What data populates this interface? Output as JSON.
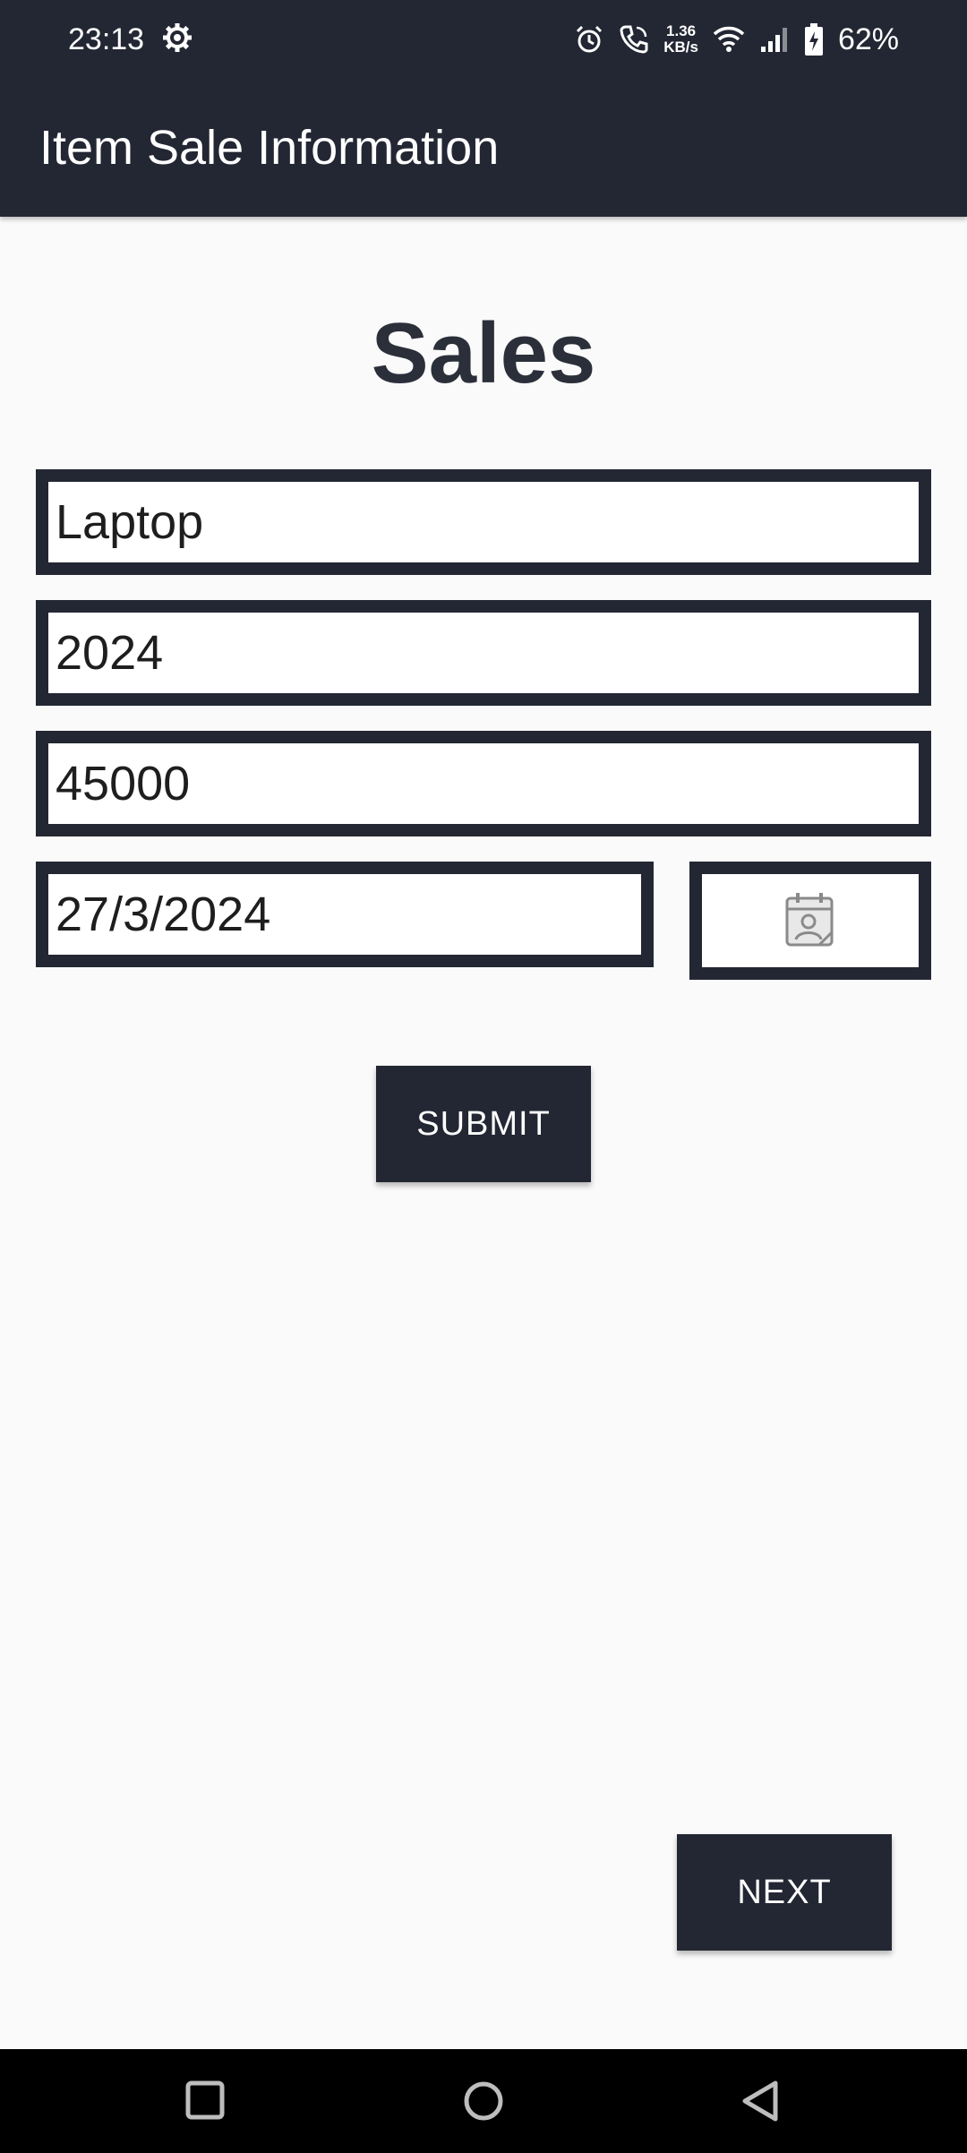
{
  "status_bar": {
    "time": "23:13",
    "net_speed_value": "1.36",
    "net_speed_unit": "KB/s",
    "battery": "62%"
  },
  "app_bar": {
    "title": "Item Sale Information"
  },
  "form": {
    "heading": "Sales",
    "item_name": "Laptop",
    "year": "2024",
    "amount": "45000",
    "date": "27/3/2024",
    "submit_label": "SUBMIT"
  },
  "footer": {
    "next_label": "NEXT"
  },
  "colors": {
    "primary_dark": "#232733",
    "background": "#fafafa",
    "heading_text": "#2b2f3a"
  },
  "icons": {
    "settings": "gear-icon",
    "alarm": "alarm-icon",
    "call": "phone-call-icon",
    "wifi": "wifi-icon",
    "signal": "signal-icon",
    "battery": "battery-charging-icon",
    "calendar": "calendar-contact-icon",
    "recents": "square-icon",
    "home": "circle-icon",
    "back": "triangle-back-icon"
  }
}
